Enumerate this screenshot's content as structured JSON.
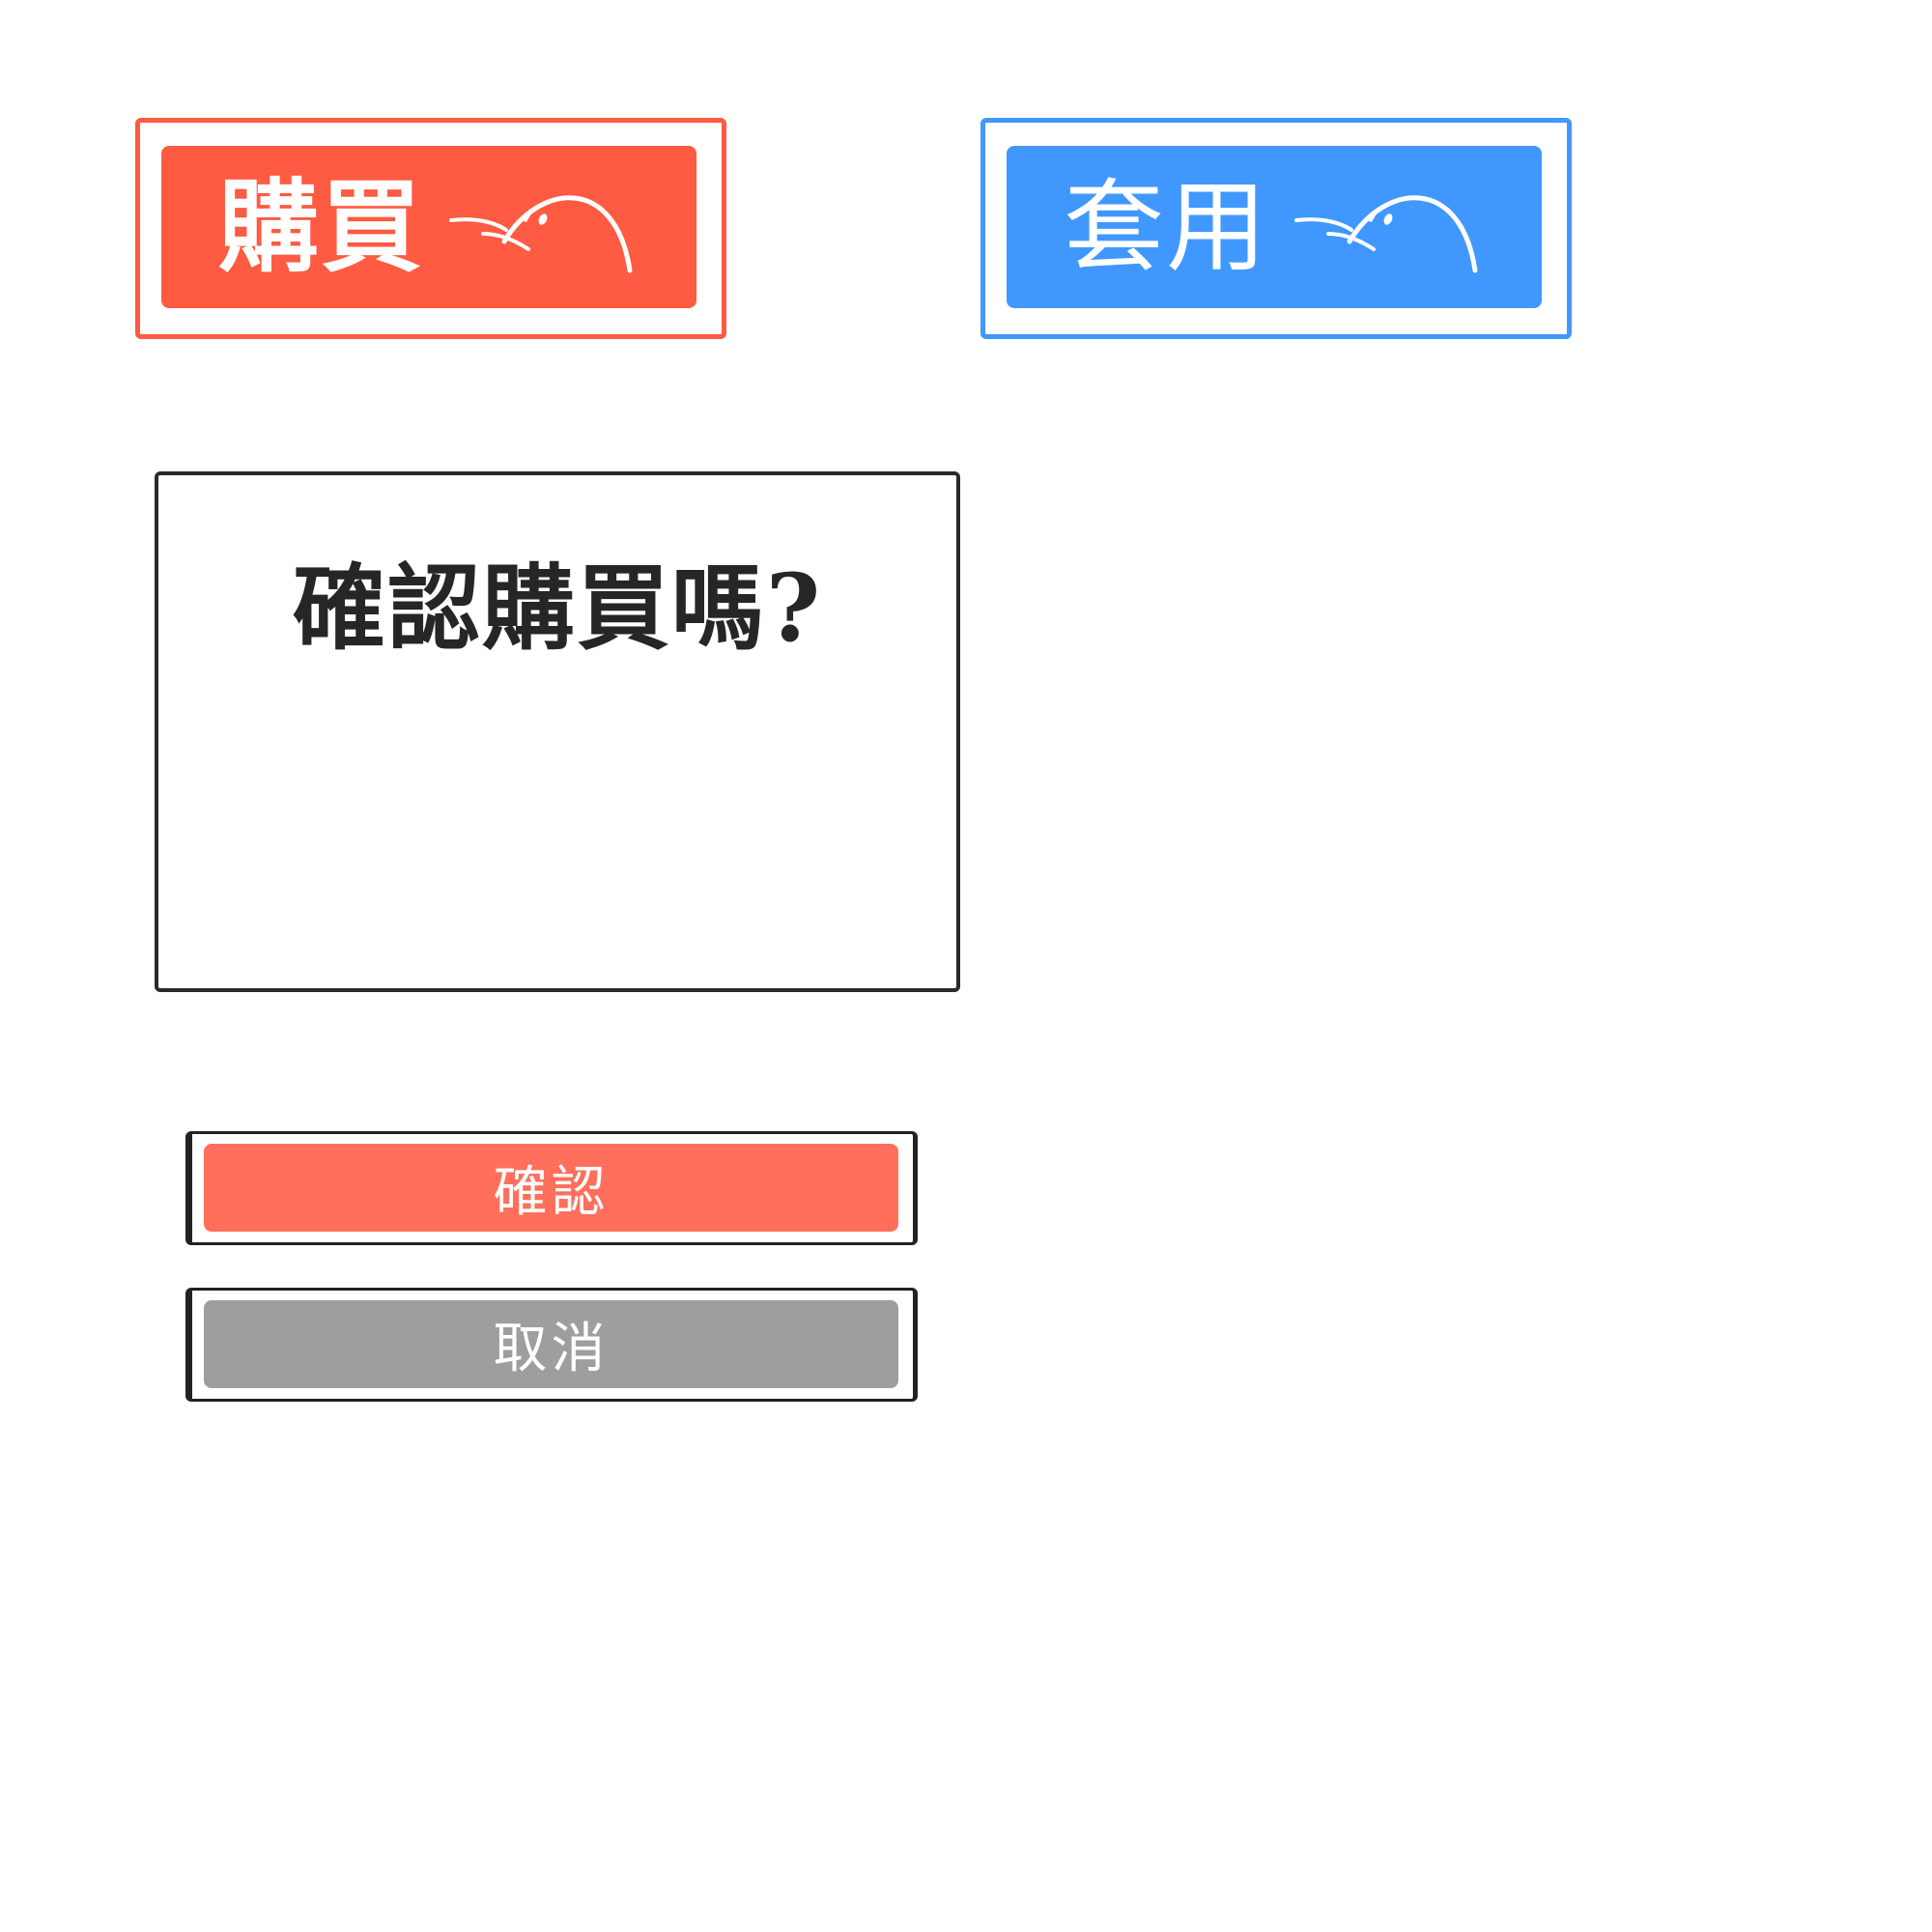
{
  "buttons": {
    "buy": {
      "label": "購買",
      "icon": "bird-peek-icon",
      "color": "#ff5a42"
    },
    "apply": {
      "label": "套用",
      "icon": "bird-peek-icon",
      "color": "#4098ff"
    }
  },
  "dialog": {
    "title": "確認購買嗎?",
    "confirm_label": "確認",
    "confirm_color": "#ff6f5b",
    "cancel_label": "取消",
    "cancel_color": "#9e9e9e"
  }
}
